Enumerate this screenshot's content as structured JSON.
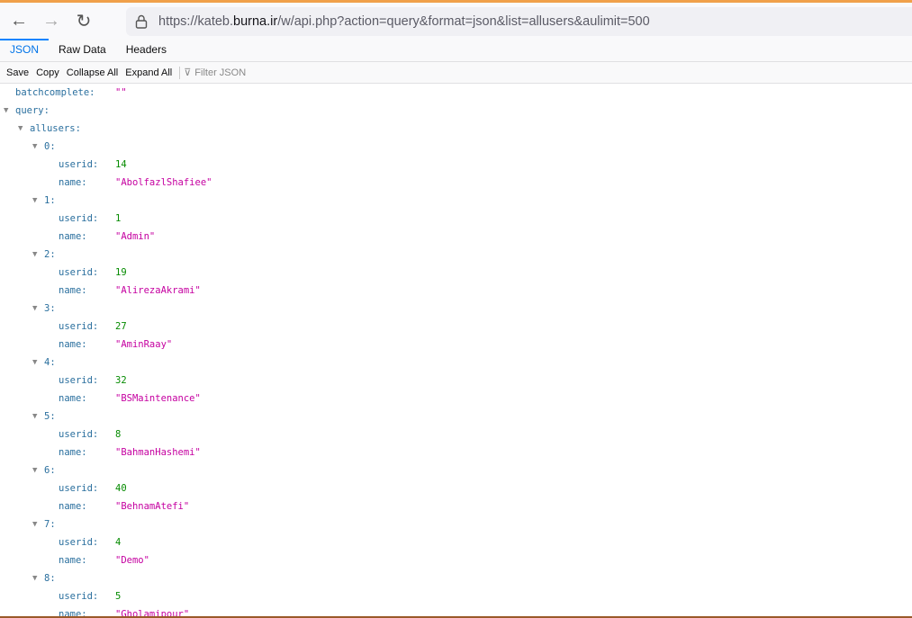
{
  "browser": {
    "url_prefix": "https://kateb.",
    "url_domain": "burna.ir",
    "url_path": "/w/api.php?action=query&format=json&list=allusers&aulimit=500"
  },
  "tabs": [
    "JSON",
    "Raw Data",
    "Headers"
  ],
  "toolbar": {
    "save": "Save",
    "copy": "Copy",
    "collapse_all": "Collapse All",
    "expand_all": "Expand All",
    "filter_placeholder": "Filter JSON"
  },
  "json": {
    "batchcomplete_key": "batchcomplete:",
    "batchcomplete_value": "\"\"",
    "query_key": "query:",
    "allusers_key": "allusers:",
    "userid_key": "userid:",
    "name_key": "name:",
    "users": [
      {
        "index": "0:",
        "userid": "14",
        "name": "\"AbolfazlShafiee\""
      },
      {
        "index": "1:",
        "userid": "1",
        "name": "\"Admin\""
      },
      {
        "index": "2:",
        "userid": "19",
        "name": "\"AlirezaAkrami\""
      },
      {
        "index": "3:",
        "userid": "27",
        "name": "\"AminRaay\""
      },
      {
        "index": "4:",
        "userid": "32",
        "name": "\"BSMaintenance\""
      },
      {
        "index": "5:",
        "userid": "8",
        "name": "\"BahmanHashemi\""
      },
      {
        "index": "6:",
        "userid": "40",
        "name": "\"BehnamAtefi\""
      },
      {
        "index": "7:",
        "userid": "4",
        "name": "\"Demo\""
      },
      {
        "index": "8:",
        "userid": "5",
        "name": "\"Gholamipour\""
      }
    ]
  }
}
